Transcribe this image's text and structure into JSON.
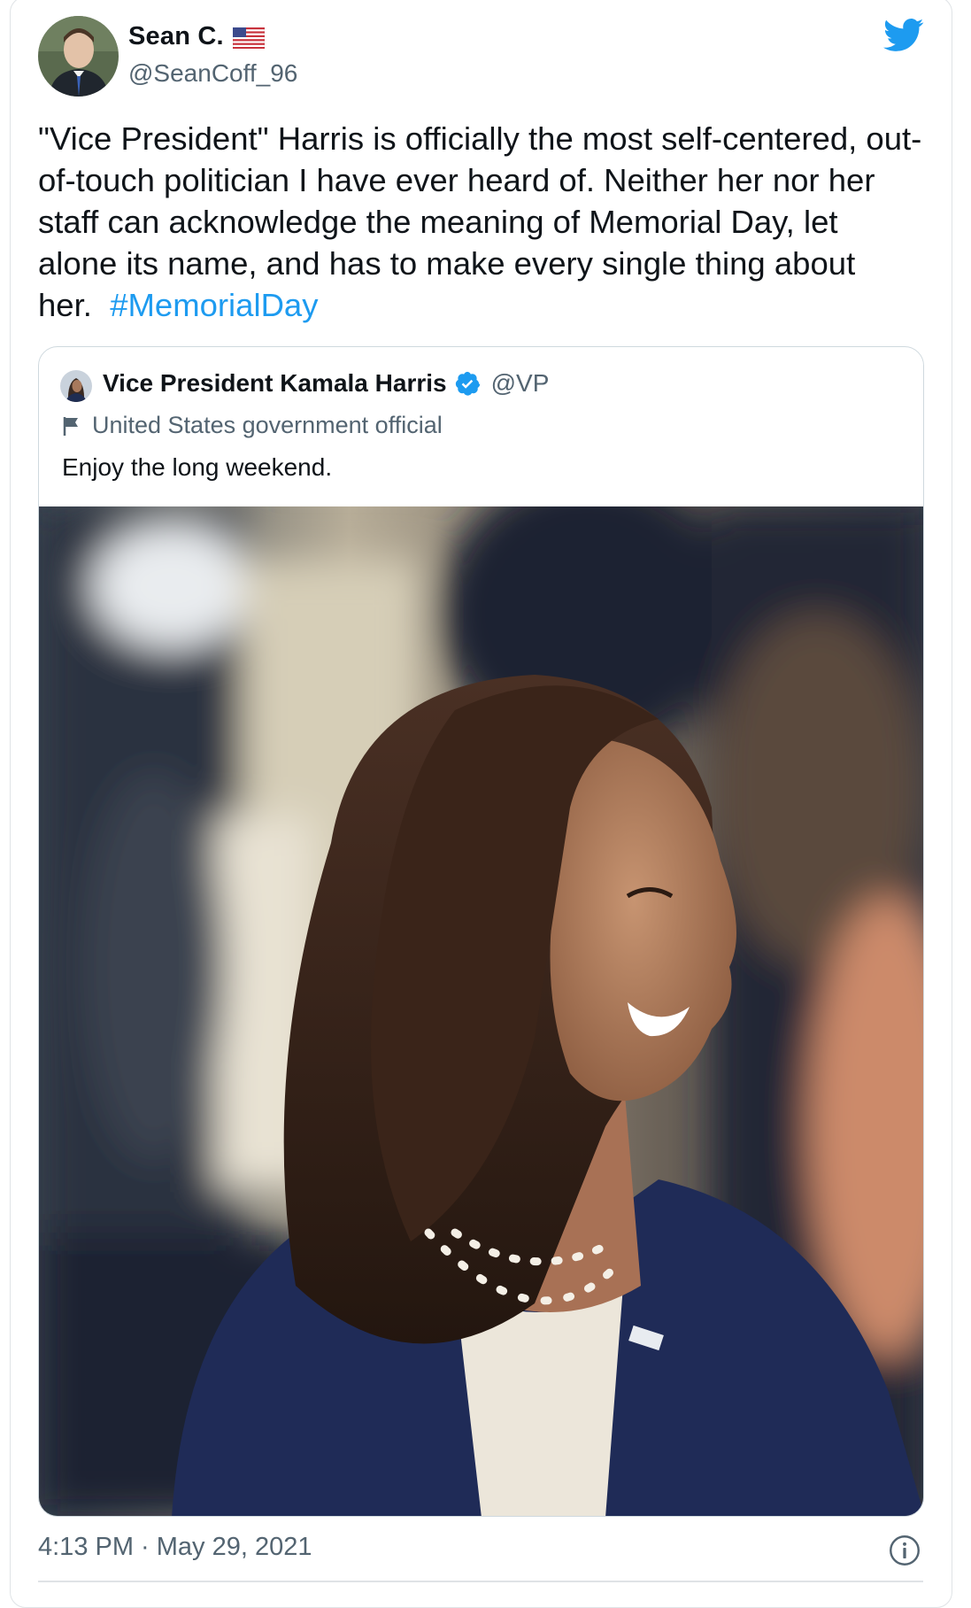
{
  "tweet": {
    "author_name": "Sean C.",
    "author_handle": "@SeanCoff_96",
    "author_flag": "us-flag-icon",
    "text_main": "\"Vice President\" Harris is officially the most self-centered, out-of-touch politician I have ever heard of. Neither her nor her staff can acknowledge the meaning of Memorial Day, let alone its name, and has to make every single thing about her.",
    "hashtag": "#MemorialDay",
    "timestamp": "4:13 PM · May 29, 2021"
  },
  "quoted_tweet": {
    "author_name": "Vice President Kamala Harris",
    "author_handle": "@VP",
    "label": "United States government official",
    "text": "Enjoy the long weekend."
  },
  "colors": {
    "accent": "#1d9bf0",
    "muted_text": "#536471",
    "border": "#cfd9de"
  },
  "icons": [
    "twitter-bird-icon",
    "verified-badge-icon",
    "flag-outline-icon",
    "info-icon"
  ]
}
